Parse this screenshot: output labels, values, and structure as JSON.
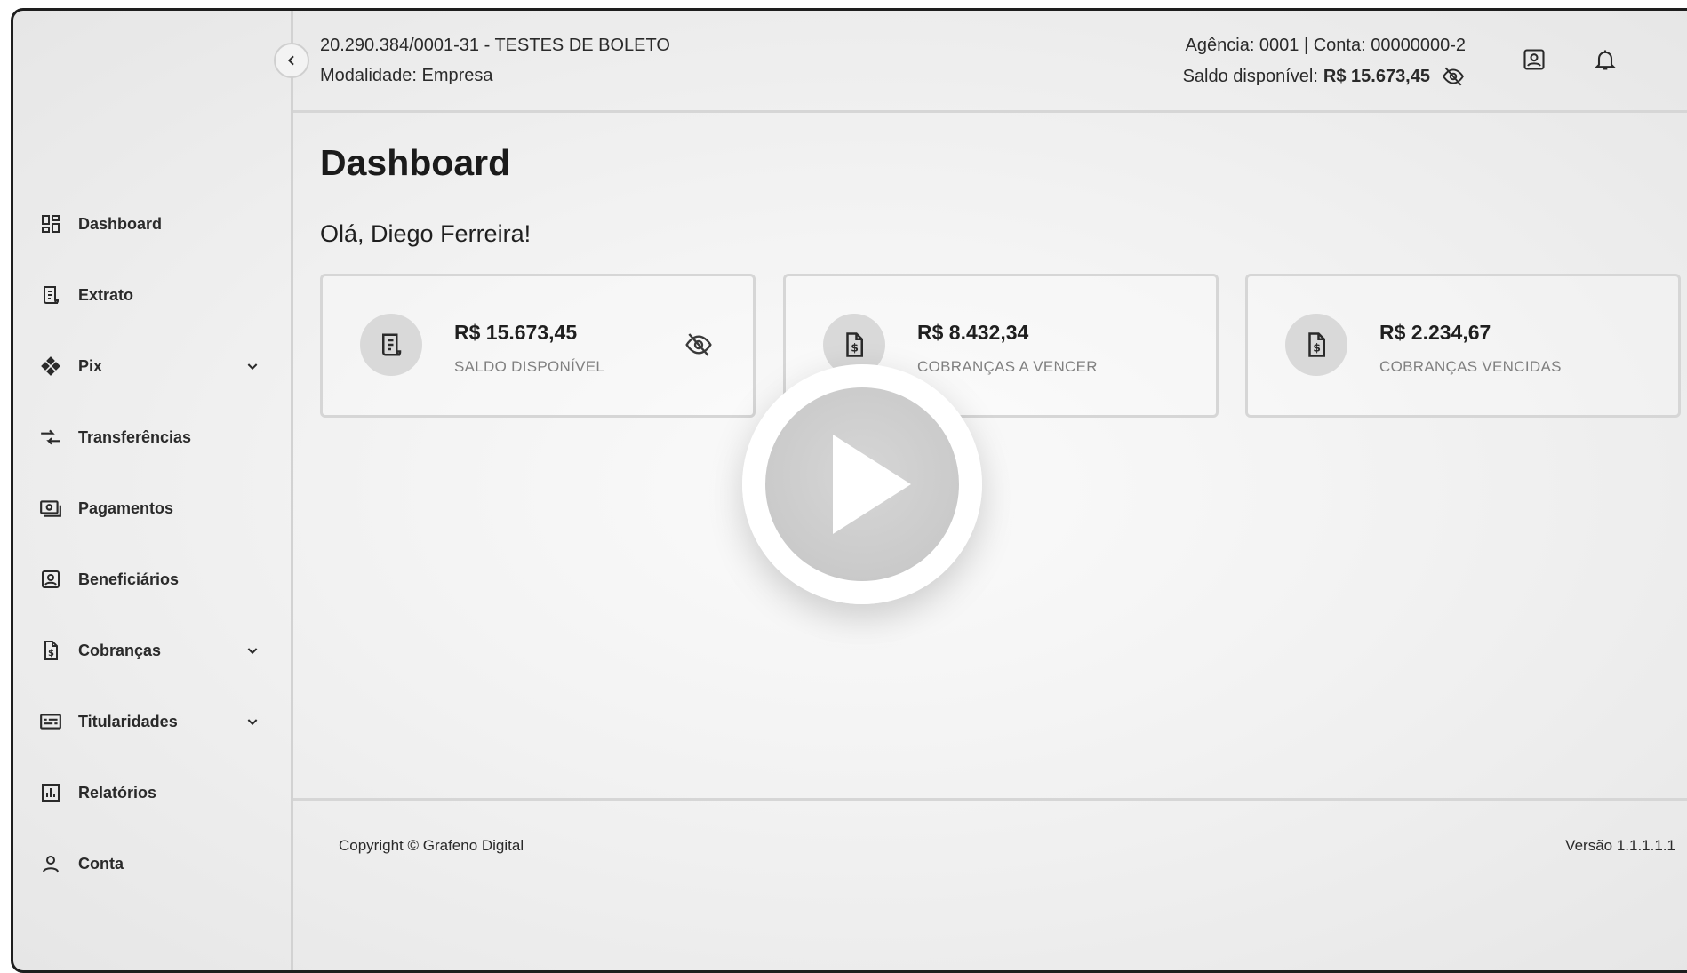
{
  "header": {
    "company": "20.290.384/0001-31 - TESTES DE BOLETO",
    "modality": "Modalidade: Empresa",
    "account_info": "Agência: 0001 | Conta: 00000000-2",
    "balance_label": "Saldo disponível:",
    "balance_value": "R$ 15.673,45",
    "icons": [
      "eye-off-icon",
      "contact-icon",
      "bell-icon"
    ]
  },
  "sidebar": {
    "items": [
      {
        "label": "Dashboard",
        "icon": "dashboard-icon",
        "active": true
      },
      {
        "label": "Extrato",
        "icon": "receipt-icon"
      },
      {
        "label": "Pix",
        "icon": "pix-icon",
        "expandable": true
      },
      {
        "label": "Transferências",
        "icon": "transfer-icon"
      },
      {
        "label": "Pagamentos",
        "icon": "payments-icon"
      },
      {
        "label": "Beneficiários",
        "icon": "beneficiary-icon"
      },
      {
        "label": "Cobranças",
        "icon": "invoice-icon",
        "expandable": true
      },
      {
        "label": "Titularidades",
        "icon": "id-card-icon",
        "expandable": true
      },
      {
        "label": "Relatórios",
        "icon": "report-icon"
      },
      {
        "label": "Conta",
        "icon": "user-icon"
      }
    ]
  },
  "main": {
    "title": "Dashboard",
    "greeting": "Olá, Diego Ferreira!",
    "cards": [
      {
        "value": "R$ 15.673,45",
        "label": "SALDO DISPONÍVEL",
        "icon": "receipt-icon"
      },
      {
        "value": "R$ 8.432,34",
        "label": "COBRANÇAS A VENCER",
        "icon": "invoice-icon"
      },
      {
        "value": "R$ 2.234,67",
        "label": "COBRANÇAS VENCIDAS",
        "icon": "invoice-icon"
      }
    ]
  },
  "footer": {
    "copyright": "Copyright © Grafeno Digital",
    "version": "Versão 1.1.1.1.1"
  },
  "colors": {
    "text": "#1f1f1f",
    "muted": "#808080",
    "border": "#d6d6d6",
    "icon_circle": "#d9d9d9"
  }
}
